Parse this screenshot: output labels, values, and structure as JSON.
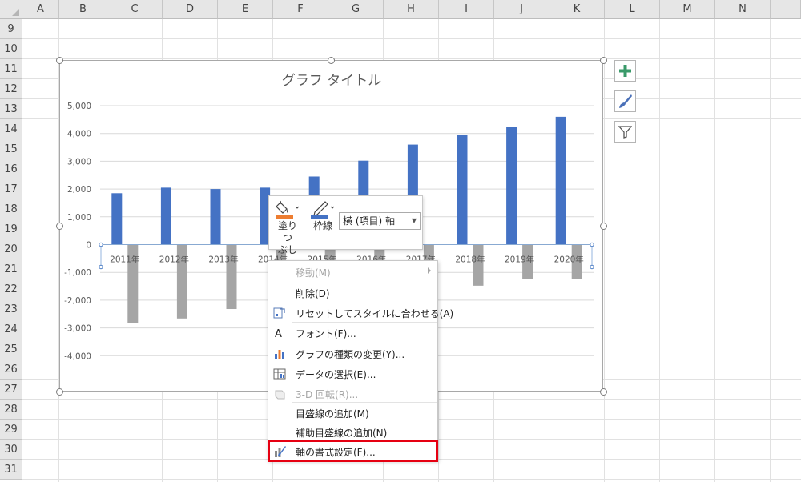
{
  "sheet": {
    "columns": [
      "A",
      "B",
      "C",
      "D",
      "E",
      "F",
      "G",
      "H",
      "I",
      "J",
      "K",
      "L",
      "M",
      "N"
    ],
    "rows": [
      "9",
      "10",
      "11",
      "12",
      "13",
      "14",
      "15",
      "16",
      "17",
      "18",
      "19",
      "20",
      "21",
      "22",
      "23",
      "24",
      "25",
      "26",
      "27",
      "28",
      "29",
      "30",
      "31"
    ]
  },
  "chart_data": {
    "type": "bar",
    "title": "グラフ タイトル",
    "categories": [
      "2011年",
      "2012年",
      "2013年",
      "2014年",
      "2015年",
      "2016年",
      "2017年",
      "2018年",
      "2019年",
      "2020年"
    ],
    "series": [
      {
        "values": [
          1850,
          2050,
          2000,
          2050,
          2450,
          3020,
          3600,
          3950,
          4230,
          4600
        ],
        "color": "#4472c4"
      },
      {
        "values": [
          -2820,
          -2660,
          -2320,
          -2000,
          -2100,
          -2000,
          -1700,
          -1480,
          -1250,
          -1250
        ],
        "color": "#a5a5a5"
      }
    ],
    "y_ticks": [
      "5,000",
      "4,000",
      "3,000",
      "2,000",
      "1,000",
      "0",
      "-1,000",
      "-2,000",
      "-3,000",
      "-4,000"
    ],
    "ylim": [
      -5000,
      5000
    ],
    "grid": true,
    "legend": "none"
  },
  "minibar": {
    "fill_label": "塗りつぶし",
    "fill_label_line1": "塗りつ",
    "fill_label_line2": "ぶし",
    "outline_label": "枠線",
    "element_select": "横 (項目) 軸",
    "fill_color": "#ed7d31",
    "outline_color": "#4472c4"
  },
  "context_menu": {
    "items": [
      {
        "label": "移動(M)",
        "disabled": true,
        "submenu": true,
        "icon": "none"
      },
      {
        "label": "削除(D)",
        "disabled": false,
        "icon": "none"
      },
      {
        "label": "リセットしてスタイルに合わせる(A)",
        "disabled": false,
        "icon": "reset-style-icon"
      },
      {
        "label": "フォント(F)...",
        "disabled": false,
        "icon": "font-icon"
      },
      {
        "label": "グラフの種類の変更(Y)...",
        "disabled": false,
        "icon": "change-chart-type-icon"
      },
      {
        "label": "データの選択(E)...",
        "disabled": false,
        "icon": "select-data-icon"
      },
      {
        "label": "3-D 回転(R)...",
        "disabled": true,
        "icon": "3d-rotation-icon"
      },
      {
        "label": "目盛線の追加(M)",
        "disabled": false,
        "icon": "none"
      },
      {
        "label": "補助目盛線の追加(N)",
        "disabled": false,
        "icon": "none"
      },
      {
        "label": "軸の書式設定(F)...",
        "disabled": false,
        "icon": "format-axis-icon"
      }
    ],
    "highlight_color": "#e60012"
  },
  "side_buttons": [
    "chart-elements-icon",
    "chart-styles-icon",
    "chart-filter-icon"
  ]
}
